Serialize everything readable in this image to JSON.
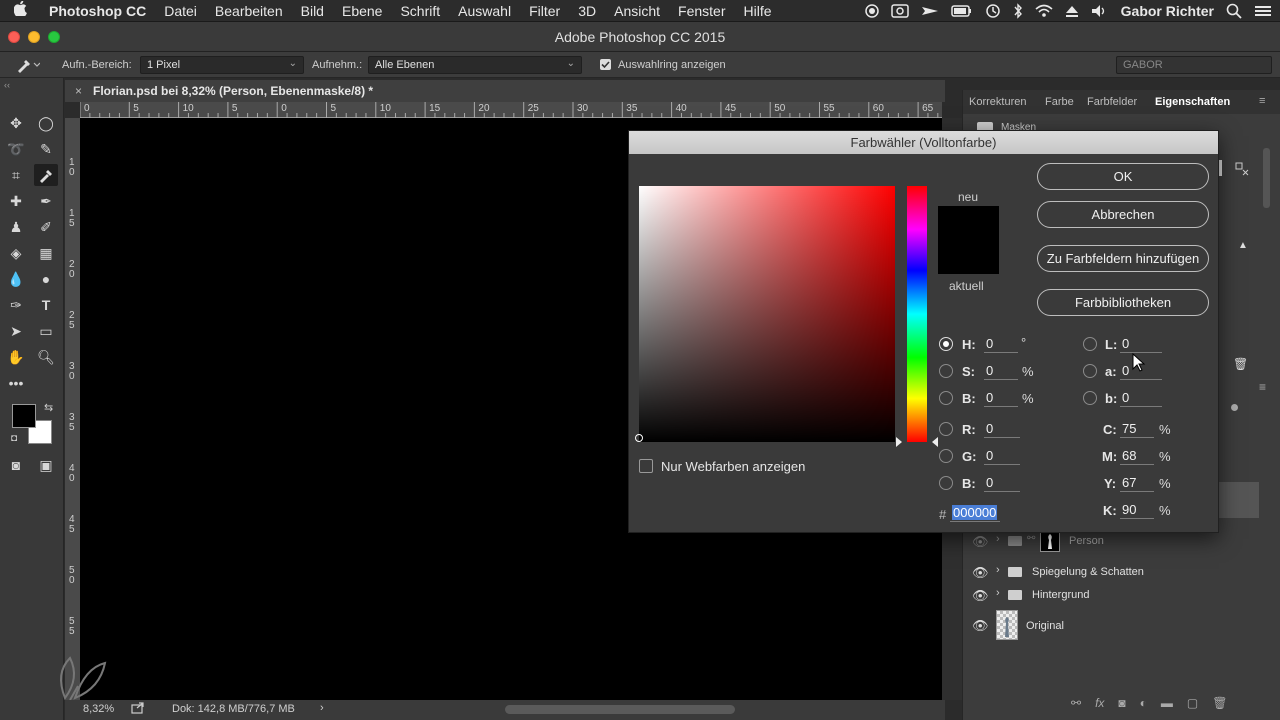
{
  "menubar": {
    "apple": "",
    "items": [
      "Photoshop CC",
      "Datei",
      "Bearbeiten",
      "Bild",
      "Ebene",
      "Schrift",
      "Auswahl",
      "Filter",
      "3D",
      "Ansicht",
      "Fenster",
      "Hilfe"
    ],
    "user": "Gabor Richter",
    "status_icons": [
      "record-icon",
      "cc-icon",
      "send-icon",
      "battery-icon",
      "history-icon",
      "bluetooth-icon",
      "wifi-icon",
      "eject-icon",
      "volume-icon",
      "spotlight-icon",
      "list-icon"
    ]
  },
  "window": {
    "title": "Adobe Photoshop CC 2015"
  },
  "options": {
    "sample_size_label": "Aufn.-Bereich:",
    "sample_size_value": "1 Pixel",
    "sample_label": "Aufnehm.:",
    "sample_value": "Alle Ebenen",
    "show_ring_label": "Auswahlring anzeigen",
    "show_ring_checked": true,
    "workspace_value": "GABOR"
  },
  "document": {
    "tab_title": "Florian.psd bei 8,32% (Person, Ebenenmaske/8) *",
    "close_glyph": "×",
    "ruler_h_labels": [
      "0",
      "5",
      "10",
      "5",
      "0",
      "5",
      "10",
      "15",
      "20",
      "25",
      "30",
      "35",
      "40",
      "45",
      "50",
      "55",
      "60",
      "65"
    ],
    "ruler_v_labels": [
      "1 0",
      "1 5",
      "2 0",
      "2 5",
      "3 0",
      "3 5",
      "4 0",
      "4 5",
      "5 0",
      "5 5"
    ],
    "zoom": "8,32%",
    "doc_info": "Dok: 142,8 MB/776,7 MB",
    "status_arrow": "›"
  },
  "panels": {
    "tabs": [
      "Korrekturen",
      "Farbe",
      "Farbfelder",
      "Eigenschaften"
    ],
    "masks_label": "Masken",
    "layers": [
      {
        "name": "Person",
        "type": "group-mask"
      },
      {
        "name": "Spiegelung & Schatten",
        "type": "group"
      },
      {
        "name": "Hintergrund",
        "type": "group"
      },
      {
        "name": "Original",
        "type": "layer"
      }
    ],
    "bottom_icons": [
      "link-icon",
      "fx-icon",
      "mask-icon",
      "adjustment-icon",
      "folder-icon",
      "new-layer-icon",
      "trash-icon"
    ]
  },
  "dialog": {
    "title": "Farbwähler (Volltonfarbe)",
    "new_label": "neu",
    "current_label": "aktuell",
    "new_color": "#000000",
    "current_color": "#000000",
    "buttons": {
      "ok": "OK",
      "cancel": "Abbrechen",
      "add_swatch": "Zu Farbfeldern hinzufügen",
      "libraries": "Farbbibliotheken"
    },
    "web_only_label": "Nur Webfarben anzeigen",
    "web_only_checked": false,
    "fields": {
      "H": {
        "label": "H:",
        "value": "0",
        "unit": "°",
        "selected": true
      },
      "S": {
        "label": "S:",
        "value": "0",
        "unit": "%"
      },
      "Bv": {
        "label": "B:",
        "value": "0",
        "unit": "%"
      },
      "R": {
        "label": "R:",
        "value": "0"
      },
      "G": {
        "label": "G:",
        "value": "0"
      },
      "B": {
        "label": "B:",
        "value": "0"
      },
      "L": {
        "label": "L:",
        "value": "0"
      },
      "a": {
        "label": "a:",
        "value": "0"
      },
      "b": {
        "label": "b:",
        "value": "0"
      },
      "C": {
        "label": "C:",
        "value": "75",
        "unit": "%"
      },
      "M": {
        "label": "M:",
        "value": "68",
        "unit": "%"
      },
      "Y": {
        "label": "Y:",
        "value": "67",
        "unit": "%"
      },
      "K": {
        "label": "K:",
        "value": "90",
        "unit": "%"
      }
    },
    "hex_label": "#",
    "hex_value": "000000"
  }
}
